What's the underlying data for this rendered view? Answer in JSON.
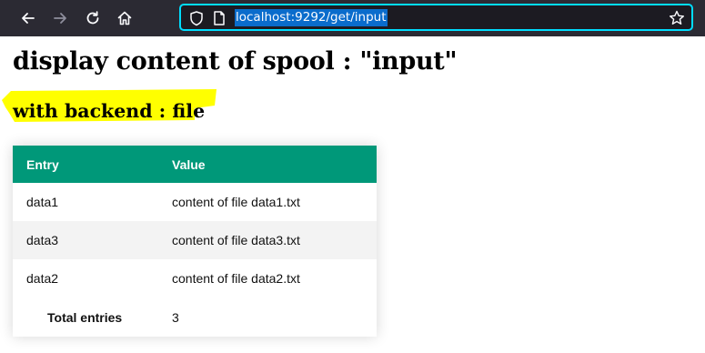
{
  "browser": {
    "url": "localhost:9292/get/input"
  },
  "page": {
    "title": "display content of spool : \"input\"",
    "subtitle": "with backend : file",
    "highlight_color": "#ffff00"
  },
  "table": {
    "header_color": "#009879",
    "columns": [
      "Entry",
      "Value"
    ],
    "rows": [
      {
        "entry": "data1",
        "value": "content of file data1.txt"
      },
      {
        "entry": "data3",
        "value": "content of file data3.txt"
      },
      {
        "entry": "data2",
        "value": "content of file data2.txt"
      }
    ],
    "total_label": "Total entries",
    "total_value": "3"
  },
  "icons": {
    "back": "back-arrow-icon",
    "forward": "forward-arrow-icon",
    "reload": "reload-icon",
    "home": "home-icon",
    "shield": "shield-icon",
    "page": "page-icon",
    "bookmark": "star-icon"
  }
}
